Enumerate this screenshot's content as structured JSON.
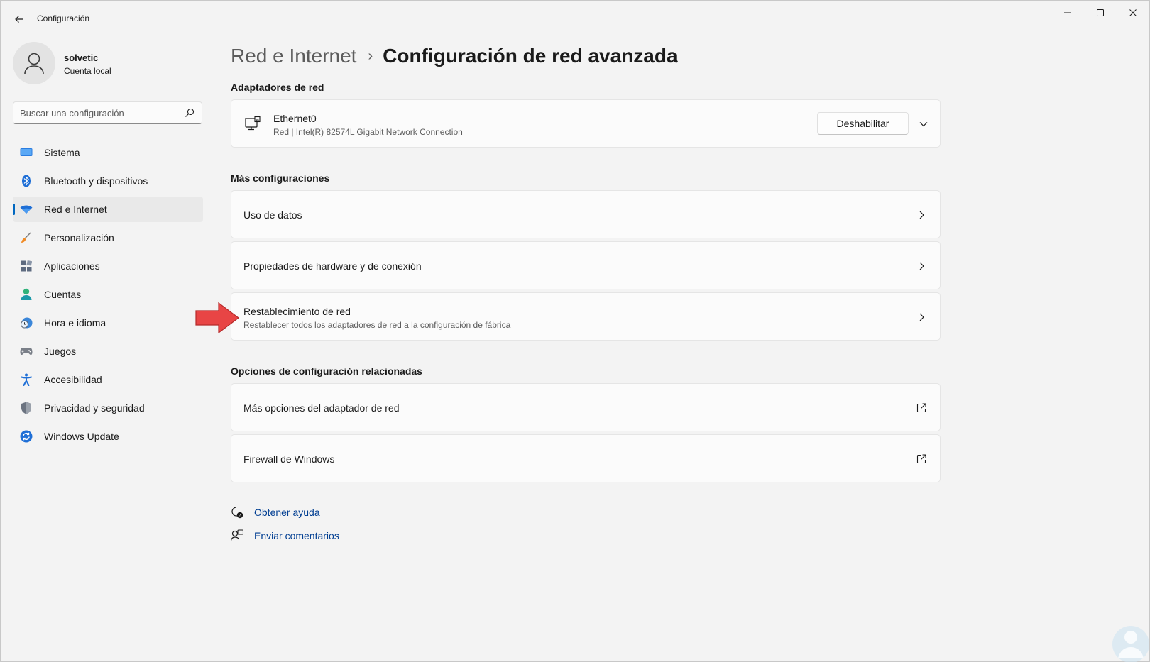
{
  "window": {
    "title": "Configuración",
    "controls": {
      "minimize": "minimize-icon",
      "maximize": "maximize-icon",
      "close": "close-icon"
    }
  },
  "user": {
    "name": "solvetic",
    "account_type": "Cuenta local"
  },
  "search": {
    "placeholder": "Buscar una configuración",
    "value": ""
  },
  "sidebar": {
    "items": [
      {
        "label": "Sistema",
        "icon": "monitor-icon",
        "active": false
      },
      {
        "label": "Bluetooth y dispositivos",
        "icon": "bluetooth-icon",
        "active": false
      },
      {
        "label": "Red e Internet",
        "icon": "wifi-icon",
        "active": true
      },
      {
        "label": "Personalización",
        "icon": "brush-icon",
        "active": false
      },
      {
        "label": "Aplicaciones",
        "icon": "apps-icon",
        "active": false
      },
      {
        "label": "Cuentas",
        "icon": "person-icon",
        "active": false
      },
      {
        "label": "Hora e idioma",
        "icon": "clock-globe-icon",
        "active": false
      },
      {
        "label": "Juegos",
        "icon": "gamepad-icon",
        "active": false
      },
      {
        "label": "Accesibilidad",
        "icon": "accessibility-icon",
        "active": false
      },
      {
        "label": "Privacidad y seguridad",
        "icon": "shield-icon",
        "active": false
      },
      {
        "label": "Windows Update",
        "icon": "update-icon",
        "active": false
      }
    ]
  },
  "header": {
    "breadcrumb_parent": "Red e Internet",
    "breadcrumb_separator": "›",
    "title": "Configuración de red avanzada"
  },
  "adapters": {
    "section_title": "Adaptadores de red",
    "items": [
      {
        "name": "Ethernet0",
        "description": "Red | Intel(R) 82574L Gigabit Network Connection",
        "button_label": "Deshabilitar"
      }
    ]
  },
  "more_settings": {
    "section_title": "Más configuraciones",
    "items": [
      {
        "title": "Uso de datos"
      },
      {
        "title": "Propiedades de hardware y de conexión"
      },
      {
        "title": "Restablecimiento de red",
        "subtitle": "Restablecer todos los adaptadores de red a la configuración de fábrica"
      }
    ]
  },
  "related": {
    "section_title": "Opciones de configuración relacionadas",
    "items": [
      {
        "title": "Más opciones del adaptador de red"
      },
      {
        "title": "Firewall de Windows"
      }
    ]
  },
  "help": {
    "get_help": "Obtener ayuda",
    "feedback": "Enviar comentarios"
  },
  "colors": {
    "accent": "#0067c0",
    "link": "#003e92",
    "annotation_arrow": "#e84545"
  }
}
